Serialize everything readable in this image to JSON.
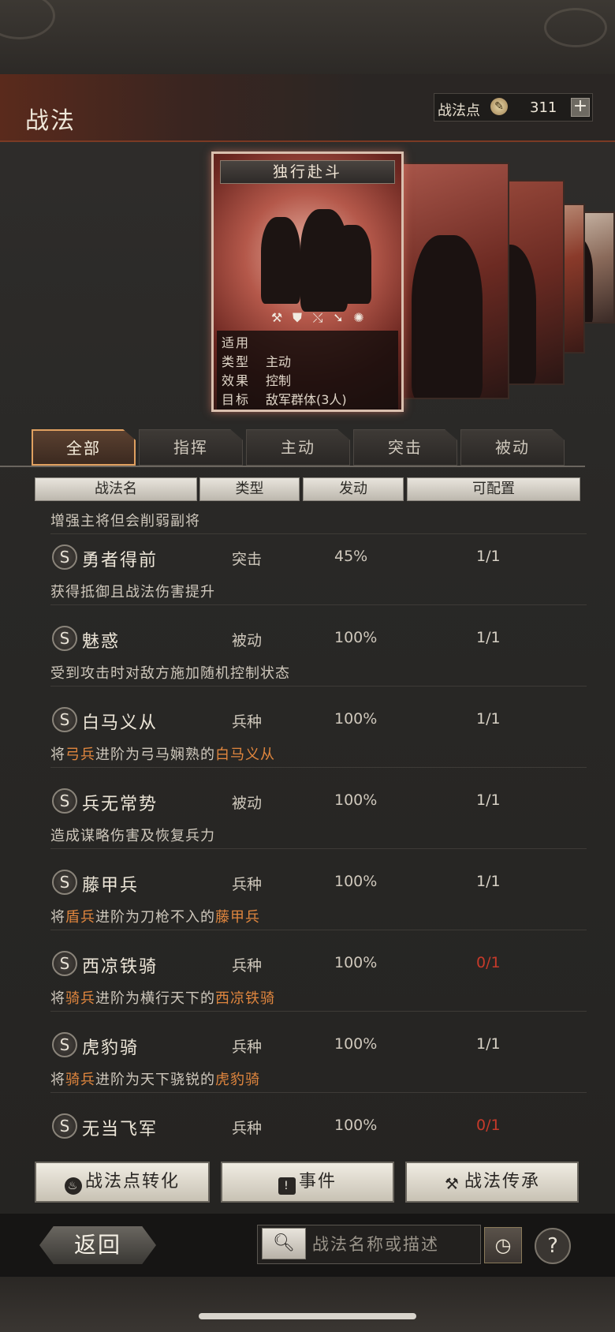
{
  "header": {
    "title": "战法",
    "points_label": "战法点",
    "points_value": "311",
    "add_symbol": "+"
  },
  "featured_card": {
    "name": "独行赴斗",
    "unit_icons": [
      "axe-icon",
      "shield-icon",
      "bow-icon",
      "spear-icon",
      "wheel-icon"
    ],
    "rows": [
      {
        "key": "适用",
        "value": ""
      },
      {
        "key": "类型",
        "value": "主动"
      },
      {
        "key": "效果",
        "value": "控制"
      },
      {
        "key": "目标",
        "value": "敌军群体(3人)"
      }
    ]
  },
  "tabs": [
    {
      "label": "全部",
      "active": true
    },
    {
      "label": "指挥",
      "active": false
    },
    {
      "label": "主动",
      "active": false
    },
    {
      "label": "突击",
      "active": false
    },
    {
      "label": "被动",
      "active": false
    }
  ],
  "columns": [
    "战法名",
    "类型",
    "发动",
    "可配置"
  ],
  "partial_desc": "增强主将但会削弱副将",
  "skills": [
    {
      "badge": "S",
      "name": "勇者得前",
      "type": "突击",
      "rate": "45%",
      "config": "1/1",
      "config_red": false,
      "desc": [
        {
          "t": "获得抵御且战法伤害提升",
          "hl": false
        }
      ]
    },
    {
      "badge": "S",
      "name": "魅惑",
      "type": "被动",
      "rate": "100%",
      "config": "1/1",
      "config_red": false,
      "desc": [
        {
          "t": "受到攻击时对敌方施加随机控制状态",
          "hl": false
        }
      ]
    },
    {
      "badge": "S",
      "name": "白马义从",
      "type": "兵种",
      "rate": "100%",
      "config": "1/1",
      "config_red": false,
      "desc": [
        {
          "t": "将",
          "hl": false
        },
        {
          "t": "弓兵",
          "hl": true
        },
        {
          "t": "进阶为弓马娴熟的",
          "hl": false
        },
        {
          "t": "白马义从",
          "hl": true
        }
      ]
    },
    {
      "badge": "S",
      "name": "兵无常势",
      "type": "被动",
      "rate": "100%",
      "config": "1/1",
      "config_red": false,
      "desc": [
        {
          "t": "造成谋略伤害及恢复兵力",
          "hl": false
        }
      ]
    },
    {
      "badge": "S",
      "name": "藤甲兵",
      "type": "兵种",
      "rate": "100%",
      "config": "1/1",
      "config_red": false,
      "desc": [
        {
          "t": "将",
          "hl": false
        },
        {
          "t": "盾兵",
          "hl": true
        },
        {
          "t": "进阶为刀枪不入的",
          "hl": false
        },
        {
          "t": "藤甲兵",
          "hl": true
        }
      ]
    },
    {
      "badge": "S",
      "name": "西凉铁骑",
      "type": "兵种",
      "rate": "100%",
      "config": "0/1",
      "config_red": true,
      "desc": [
        {
          "t": "将",
          "hl": false
        },
        {
          "t": "骑兵",
          "hl": true
        },
        {
          "t": "进阶为横行天下的",
          "hl": false
        },
        {
          "t": "西凉铁骑",
          "hl": true
        }
      ]
    },
    {
      "badge": "S",
      "name": "虎豹骑",
      "type": "兵种",
      "rate": "100%",
      "config": "1/1",
      "config_red": false,
      "desc": [
        {
          "t": "将",
          "hl": false
        },
        {
          "t": "骑兵",
          "hl": true
        },
        {
          "t": "进阶为天下骁锐的",
          "hl": false
        },
        {
          "t": "虎豹骑",
          "hl": true
        }
      ]
    },
    {
      "badge": "S",
      "name": "无当飞军",
      "type": "兵种",
      "rate": "100%",
      "config": "0/1",
      "config_red": true,
      "desc": []
    }
  ],
  "buttons": {
    "convert": "战法点转化",
    "events": "事件",
    "inherit": "战法传承"
  },
  "footer": {
    "back": "返回",
    "search_placeholder": "战法名称或描述",
    "help": "?"
  },
  "colors": {
    "highlight": "#e0863e",
    "warning": "#c63a2a",
    "active_tab_border": "#e0a060"
  }
}
